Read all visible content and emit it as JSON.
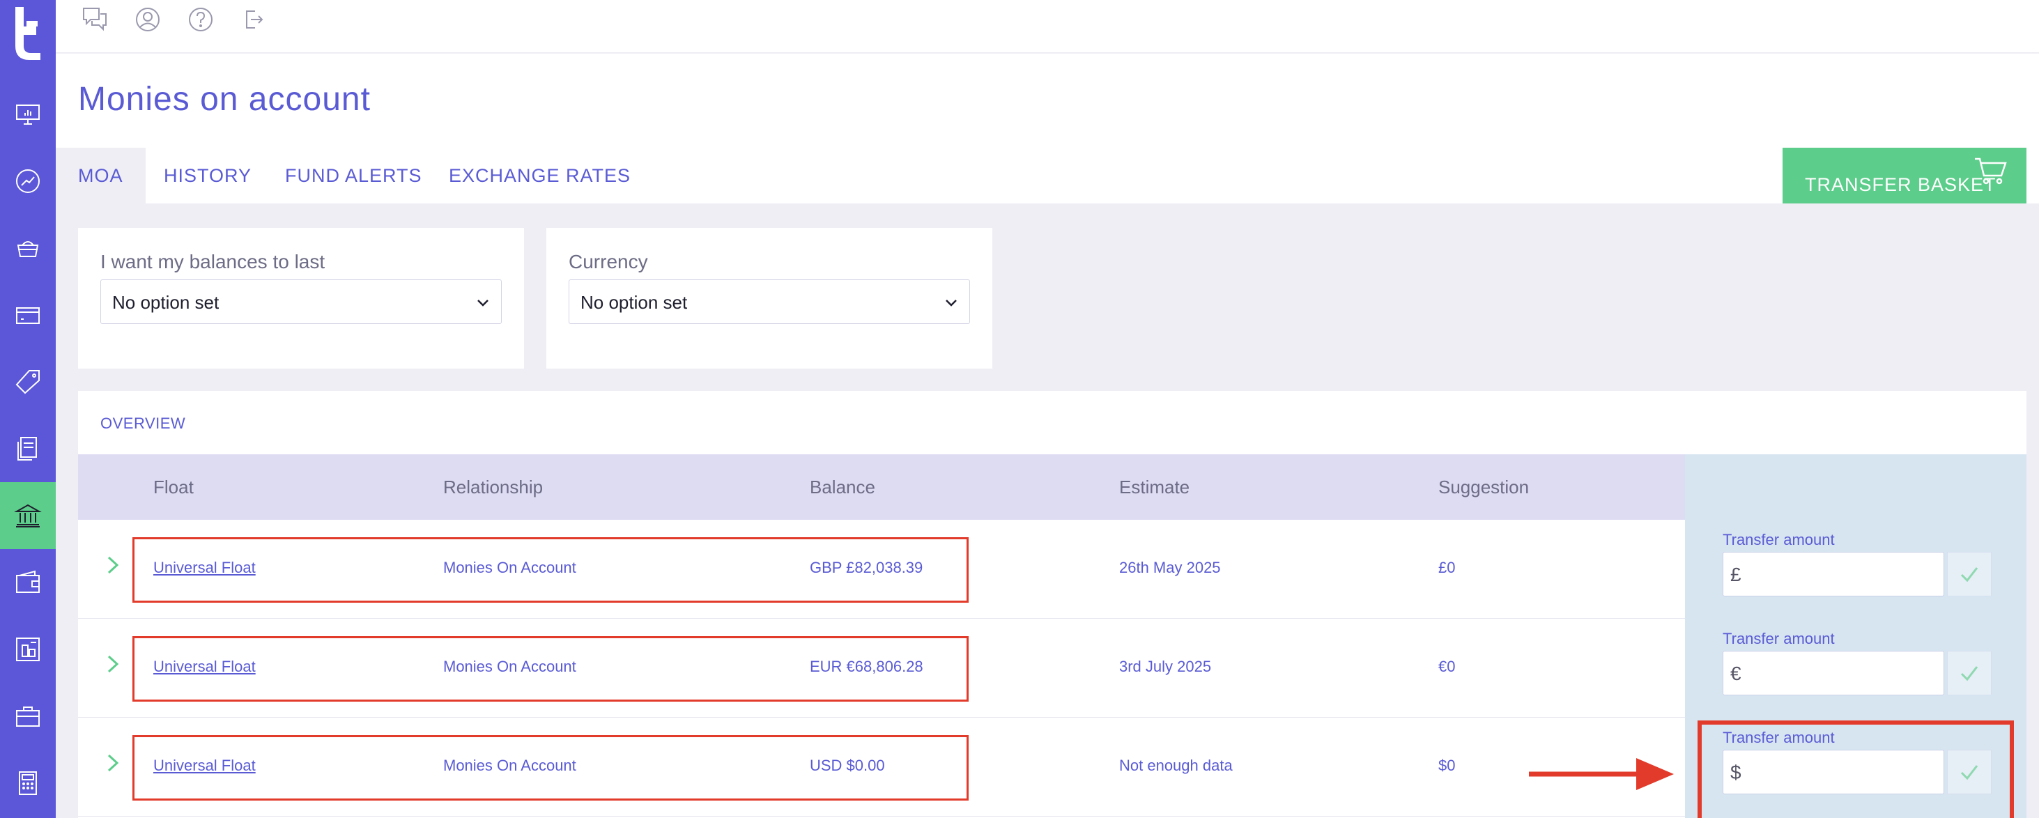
{
  "topbar": {
    "icons": [
      "chat-icon",
      "user-icon",
      "help-icon",
      "logout-icon"
    ]
  },
  "sidebar": {
    "items": [
      {
        "name": "presentation-icon",
        "active": false
      },
      {
        "name": "trend-icon",
        "active": false
      },
      {
        "name": "basket-icon",
        "active": false
      },
      {
        "name": "card-icon",
        "active": false
      },
      {
        "name": "tag-icon",
        "active": false
      },
      {
        "name": "documents-icon",
        "active": false
      },
      {
        "name": "bank-icon",
        "active": true
      },
      {
        "name": "wallet-icon",
        "active": false
      },
      {
        "name": "floorplan-icon",
        "active": false
      },
      {
        "name": "briefcase-icon",
        "active": false
      },
      {
        "name": "calculator-icon",
        "active": false
      }
    ]
  },
  "page": {
    "title": "Monies on account"
  },
  "tabs": [
    "MOA",
    "HISTORY",
    "FUND ALERTS",
    "EXCHANGE RATES"
  ],
  "transfer_basket": {
    "label": "TRANSFER BASKET"
  },
  "filters": {
    "balances": {
      "label": "I want my balances to last",
      "value": "No option set"
    },
    "currency": {
      "label": "Currency",
      "value": "No option set"
    }
  },
  "overview": {
    "title": "OVERVIEW",
    "headers": [
      "Float",
      "Relationship",
      "Balance",
      "Estimate",
      "Suggestion"
    ],
    "rows": [
      {
        "float": "Universal Float",
        "relationship": "Monies On Account",
        "balance": "GBP £82,038.39",
        "estimate": "26th May 2025",
        "suggestion": "£0",
        "transfer_label": "Transfer amount",
        "currency_sign": "£"
      },
      {
        "float": "Universal Float",
        "relationship": "Monies On Account",
        "balance": "EUR €68,806.28",
        "estimate": "3rd July 2025",
        "suggestion": "€0",
        "transfer_label": "Transfer amount",
        "currency_sign": "€"
      },
      {
        "float": "Universal Float",
        "relationship": "Monies On Account",
        "balance": "USD $0.00",
        "estimate": "Not enough data",
        "suggestion": "$0",
        "transfer_label": "Transfer amount",
        "currency_sign": "$"
      }
    ]
  },
  "colors": {
    "primary": "#5b57d8",
    "accent_green": "#5ccd8a",
    "annotation_red": "#e23b2b",
    "background": "#efeef5"
  }
}
